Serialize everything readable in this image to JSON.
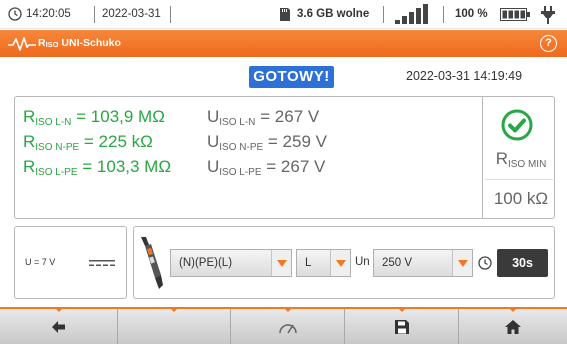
{
  "status_bar": {
    "clock_icon": "clock-icon",
    "time": "14:20:05",
    "date": "2022-03-31",
    "memory_icon": "sd-card-icon",
    "memory": "3.6 GB wolne",
    "signal_icon": "signal-bars-icon",
    "battery_percent": "100 %",
    "battery_icon": "battery-icon",
    "power_icon": "plug-icon"
  },
  "title_bar": {
    "icon": "waveform-icon",
    "title_main": "R",
    "title_sub": "ISO",
    "title_rest": " UNI-Schuko",
    "help_label": "?"
  },
  "status": {
    "ready_label": "GOTOWY!",
    "timestamp": "2022-03-31 14:19:49"
  },
  "results": {
    "rows": [
      {
        "r_main": "R",
        "r_sub": "ISO L-N",
        "r_value": " = 103,9 MΩ",
        "u_main": "U",
        "u_sub": "ISO L-N",
        "u_value": " = 267 V"
      },
      {
        "r_main": "R",
        "r_sub": "ISO N-PE",
        "r_value": " = 225 kΩ",
        "u_main": "U",
        "u_sub": "ISO N-PE",
        "u_value": " = 259 V"
      },
      {
        "r_main": "R",
        "r_sub": "ISO L-PE",
        "r_value": " = 103,3 MΩ",
        "u_main": "U",
        "u_sub": "ISO L-PE",
        "u_value": " = 267 V"
      }
    ],
    "pass_icon": "check-circle-icon",
    "rmin_main": "R",
    "rmin_sub": "ISO MIN",
    "rmin_value": "100 kΩ"
  },
  "voltage_panel": {
    "label": "U = 7 V",
    "dc_icon": "dc-symbol-icon"
  },
  "controls": {
    "probe_icon": "probe-icon",
    "mode_value": "(N)(PE)(L)",
    "line_value": "L",
    "un_label": "Un",
    "un_value": "250 V",
    "timer_icon": "stopwatch-icon",
    "time_value": "30s"
  },
  "toolbar": {
    "buttons": [
      "back-arrow-icon",
      "empty",
      "gauge-icon",
      "save-icon",
      "home-icon"
    ]
  },
  "colors": {
    "accent": "#f07a22",
    "ready_blue": "#2d71d6",
    "pass_green": "#28a745"
  }
}
